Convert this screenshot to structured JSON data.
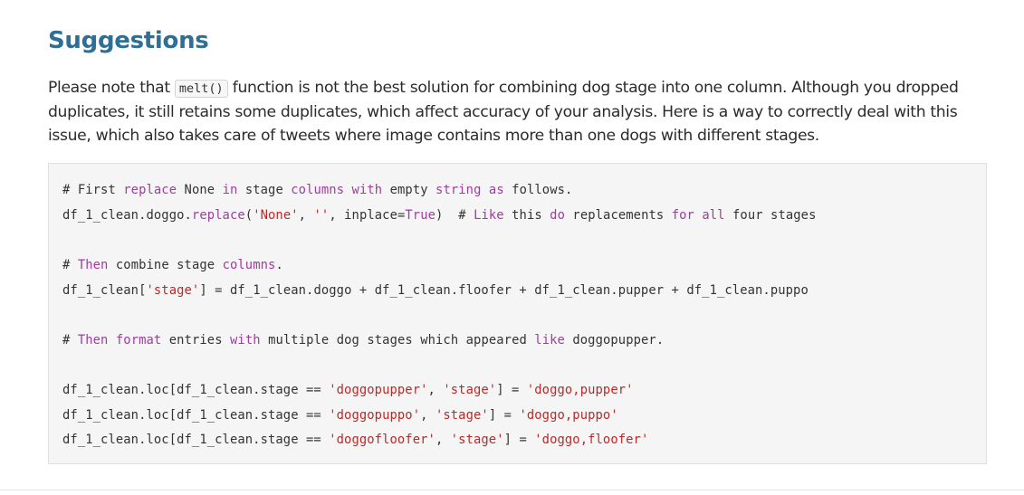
{
  "heading": "Suggestions",
  "paragraph": {
    "before": "Please note that ",
    "code": "melt()",
    "after": " function is not the best solution for combining dog stage into one column. Although you dropped duplicates, it still retains some duplicates, which affect accuracy of your analysis. Here is a way to correctly deal with this issue, which also takes care of tweets where image contains more than one dogs with different stages."
  },
  "code_lines": [
    [
      {
        "t": "# First ",
        "c": ""
      },
      {
        "t": "replace",
        "c": "kw"
      },
      {
        "t": " None ",
        "c": ""
      },
      {
        "t": "in",
        "c": "kw"
      },
      {
        "t": " stage ",
        "c": ""
      },
      {
        "t": "columns",
        "c": "kw"
      },
      {
        "t": " ",
        "c": ""
      },
      {
        "t": "with",
        "c": "kw"
      },
      {
        "t": " empty ",
        "c": ""
      },
      {
        "t": "string",
        "c": "kw"
      },
      {
        "t": " ",
        "c": ""
      },
      {
        "t": "as",
        "c": "kw"
      },
      {
        "t": " follows.",
        "c": ""
      }
    ],
    [
      {
        "t": "df_1_clean.doggo.",
        "c": ""
      },
      {
        "t": "replace",
        "c": "kw"
      },
      {
        "t": "(",
        "c": ""
      },
      {
        "t": "'None'",
        "c": "str"
      },
      {
        "t": ", ",
        "c": ""
      },
      {
        "t": "''",
        "c": "str"
      },
      {
        "t": ", inplace=",
        "c": ""
      },
      {
        "t": "True",
        "c": "kw"
      },
      {
        "t": ")  # ",
        "c": ""
      },
      {
        "t": "Like",
        "c": "kw"
      },
      {
        "t": " this ",
        "c": ""
      },
      {
        "t": "do",
        "c": "kw"
      },
      {
        "t": " replacements ",
        "c": ""
      },
      {
        "t": "for",
        "c": "kw"
      },
      {
        "t": " ",
        "c": ""
      },
      {
        "t": "all",
        "c": "kw"
      },
      {
        "t": " four stages",
        "c": ""
      }
    ],
    [
      {
        "t": "# ",
        "c": ""
      },
      {
        "t": "Then",
        "c": "kw"
      },
      {
        "t": " combine stage ",
        "c": ""
      },
      {
        "t": "columns",
        "c": "kw"
      },
      {
        "t": ".",
        "c": ""
      }
    ],
    [
      {
        "t": "df_1_clean[",
        "c": ""
      },
      {
        "t": "'stage'",
        "c": "str"
      },
      {
        "t": "] = df_1_clean.doggo + df_1_clean.floofer + df_1_clean.pupper + df_1_clean.puppo",
        "c": ""
      }
    ],
    [
      {
        "t": "# ",
        "c": ""
      },
      {
        "t": "Then",
        "c": "kw"
      },
      {
        "t": " ",
        "c": ""
      },
      {
        "t": "format",
        "c": "kw"
      },
      {
        "t": " entries ",
        "c": ""
      },
      {
        "t": "with",
        "c": "kw"
      },
      {
        "t": " multiple dog stages which appeared ",
        "c": ""
      },
      {
        "t": "like",
        "c": "kw"
      },
      {
        "t": " doggopupper.",
        "c": ""
      }
    ],
    [
      {
        "t": "df_1_clean.loc[df_1_clean.stage == ",
        "c": ""
      },
      {
        "t": "'doggopupper'",
        "c": "str"
      },
      {
        "t": ", ",
        "c": ""
      },
      {
        "t": "'stage'",
        "c": "str"
      },
      {
        "t": "] = ",
        "c": ""
      },
      {
        "t": "'doggo,pupper'",
        "c": "str"
      }
    ],
    [
      {
        "t": "df_1_clean.loc[df_1_clean.stage == ",
        "c": ""
      },
      {
        "t": "'doggopuppo'",
        "c": "str"
      },
      {
        "t": ", ",
        "c": ""
      },
      {
        "t": "'stage'",
        "c": "str"
      },
      {
        "t": "] = ",
        "c": ""
      },
      {
        "t": "'doggo,puppo'",
        "c": "str"
      }
    ],
    [
      {
        "t": "df_1_clean.loc[df_1_clean.stage == ",
        "c": ""
      },
      {
        "t": "'doggofloofer'",
        "c": "str"
      },
      {
        "t": ", ",
        "c": ""
      },
      {
        "t": "'stage'",
        "c": "str"
      },
      {
        "t": "] = ",
        "c": ""
      },
      {
        "t": "'doggo,floofer'",
        "c": "str"
      }
    ]
  ],
  "colors": {
    "heading": "#2e6f96",
    "keyword": "#a03ca0",
    "string": "#b82a2a"
  }
}
